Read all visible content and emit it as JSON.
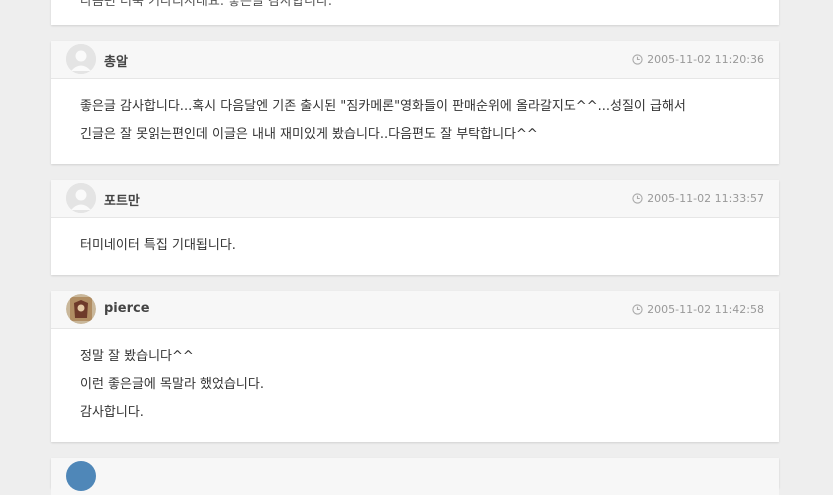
{
  "comments": [
    {
      "author": "",
      "date": "",
      "lines": [
        "다음편 더욱 기다리시네요. 좋은글 감사합니다."
      ]
    },
    {
      "author": "총알",
      "date": "2005-11-02 11:20:36",
      "lines": [
        "좋은글 감사합니다...혹시 다음달엔 기존 출시된 \"짐카메론\"영화들이 판매순위에 올라갈지도^^...성질이 급해서",
        "긴글은 잘 못읽는편인데 이글은 내내 재미있게 봤습니다..다음편도 잘 부탁합니다^^"
      ]
    },
    {
      "author": "포트만",
      "date": "2005-11-02 11:33:57",
      "lines": [
        "터미네이터 특집 기대됩니다."
      ]
    },
    {
      "author": "pierce",
      "date": "2005-11-02 11:42:58",
      "lines": [
        "정말 잘 봤습니다^^",
        "이런 좋은글에 목말라 했었습니다.",
        "감사합니다."
      ]
    }
  ]
}
